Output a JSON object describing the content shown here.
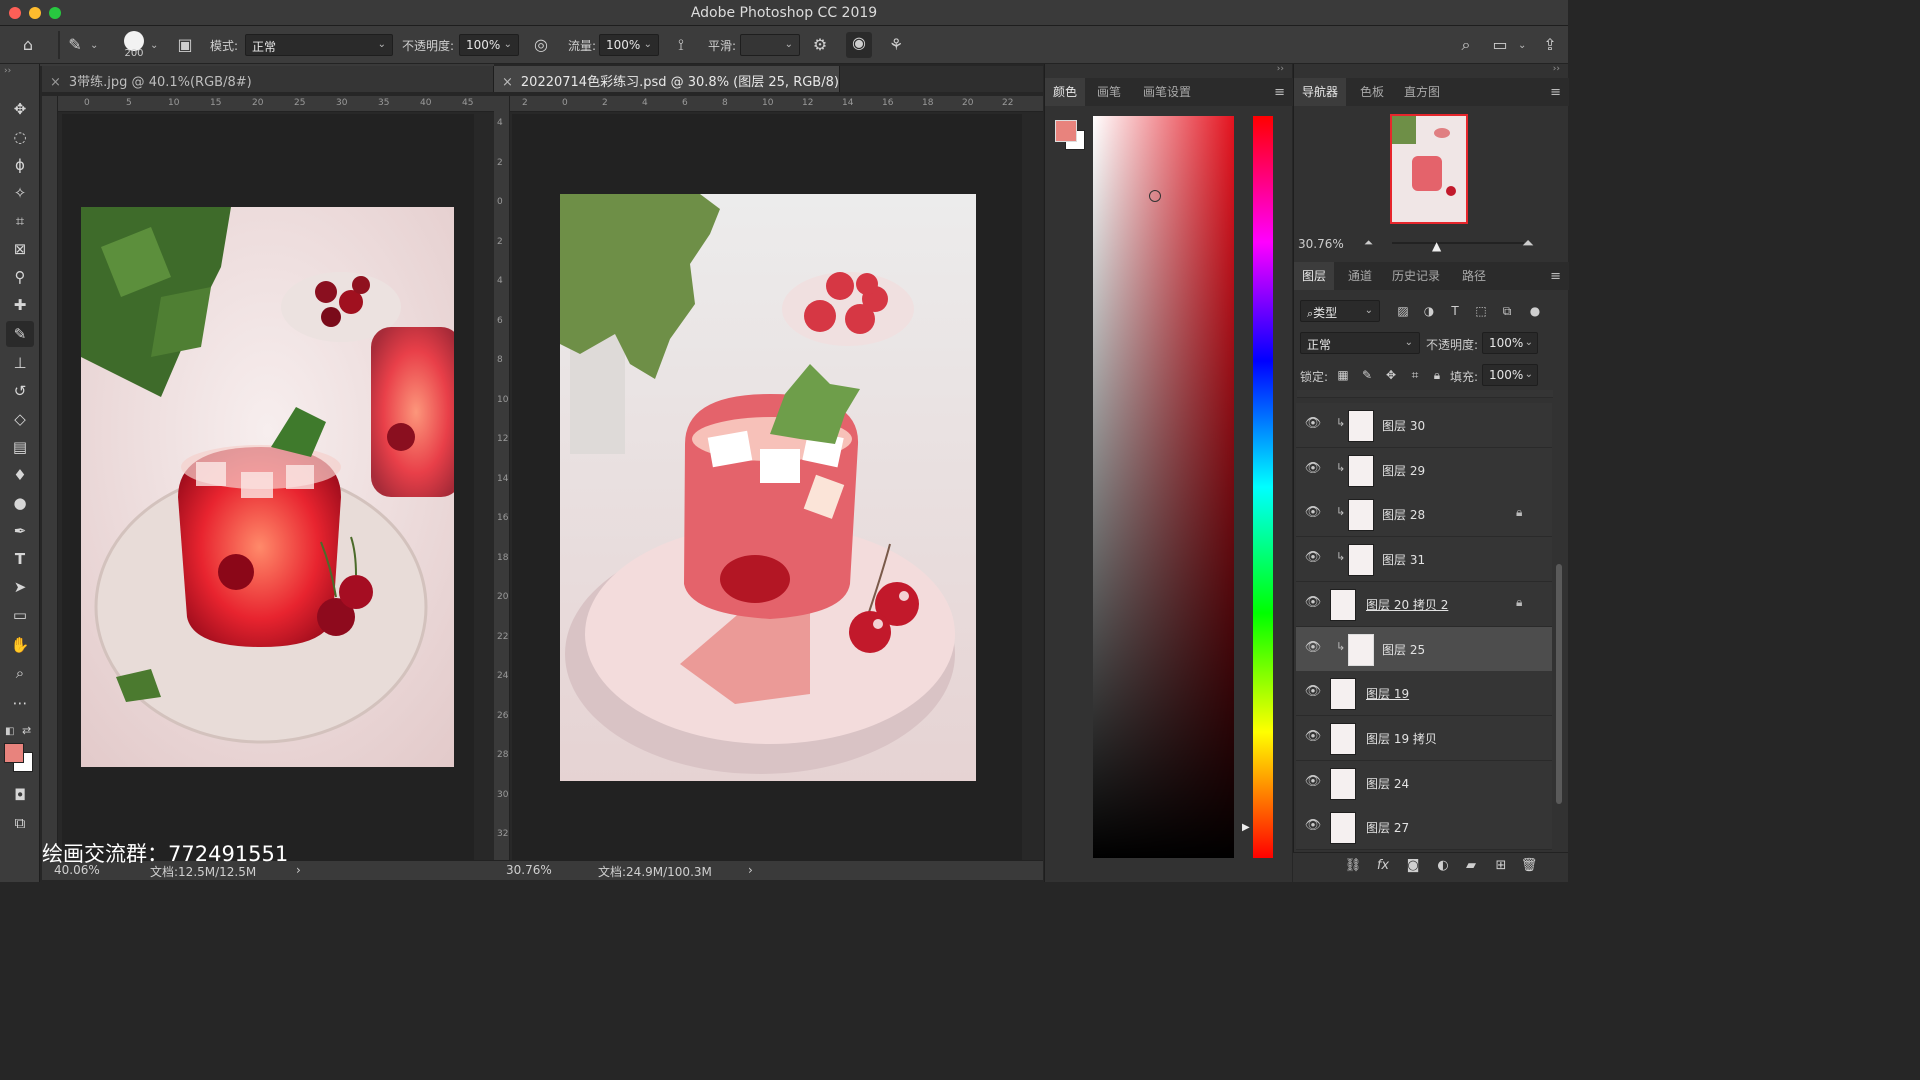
{
  "app": {
    "title": "Adobe Photoshop CC 2019"
  },
  "options": {
    "brush_size": "200",
    "mode_label": "模式:",
    "mode_value": "正常",
    "opacity_label": "不透明度:",
    "opacity_value": "100%",
    "flow_label": "流量:",
    "flow_value": "100%",
    "smooth_label": "平滑:",
    "smooth_value": ""
  },
  "documents": {
    "left": {
      "tab": "3带练.jpg @ 40.1%(RGB/8#)",
      "zoom": "40.06%",
      "doc_size": "文档:12.5M/12.5M"
    },
    "right": {
      "tab": "20220714色彩练习.psd @ 30.8% (图层 25, RGB/8)",
      "zoom": "30.76%",
      "doc_size": "文档:24.9M/100.3M"
    }
  },
  "ruler_left_h": [
    "0",
    "5",
    "10",
    "15",
    "20",
    "25",
    "30",
    "35",
    "40",
    "45"
  ],
  "ruler_right_h": [
    "2",
    "0",
    "2",
    "4",
    "6",
    "8",
    "10",
    "12",
    "14",
    "16",
    "18",
    "20",
    "22"
  ],
  "ruler_right_v": [
    "4",
    "2",
    "0",
    "2",
    "4",
    "6",
    "8",
    "10",
    "12",
    "14",
    "16",
    "18",
    "20",
    "22",
    "24",
    "26",
    "28",
    "30",
    "32"
  ],
  "watermark": "绘画交流群：772491551",
  "color_panel": {
    "tabs": [
      "颜色",
      "画笔",
      "画笔设置"
    ],
    "foreground": "#e8837d",
    "background": "#ffffff"
  },
  "navigator": {
    "tabs": [
      "导航器",
      "色板",
      "直方图"
    ],
    "zoom": "30.76%"
  },
  "layers_panel": {
    "tabs": [
      "图层",
      "通道",
      "历史记录",
      "路径"
    ],
    "filter": "类型",
    "blend_mode": "正常",
    "opacity_label": "不透明度:",
    "opacity_value": "100%",
    "lock_label": "锁定:",
    "fill_label": "填充:",
    "fill_value": "100%",
    "layers": [
      {
        "name": "图层 30",
        "clipped": true,
        "locked": false,
        "selected": false,
        "underlined": false
      },
      {
        "name": "图层 29",
        "clipped": true,
        "locked": false,
        "selected": false,
        "underlined": false
      },
      {
        "name": "图层 28",
        "clipped": true,
        "locked": true,
        "selected": false,
        "underlined": false
      },
      {
        "name": "图层 31",
        "clipped": true,
        "locked": false,
        "selected": false,
        "underlined": false
      },
      {
        "name": "图层 20 拷贝 2",
        "clipped": false,
        "locked": true,
        "selected": false,
        "underlined": true
      },
      {
        "name": "图层 25",
        "clipped": true,
        "locked": false,
        "selected": true,
        "underlined": false
      },
      {
        "name": "图层 19",
        "clipped": false,
        "locked": false,
        "selected": false,
        "underlined": true
      },
      {
        "name": "图层 19 拷贝",
        "clipped": false,
        "locked": false,
        "selected": false,
        "underlined": false
      },
      {
        "name": "图层 24",
        "clipped": false,
        "locked": false,
        "selected": false,
        "underlined": false
      },
      {
        "name": "图层 27",
        "clipped": false,
        "locked": false,
        "selected": false,
        "underlined": false
      }
    ]
  }
}
